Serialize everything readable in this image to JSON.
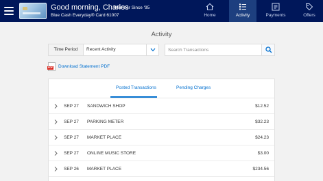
{
  "header": {
    "greeting": "Good morning, Charles",
    "member_since": "Member Since '95",
    "card_name": "Blue Cash Everyday® Card 61007",
    "nav": [
      {
        "label": "Home",
        "icon": "home-icon",
        "active": false
      },
      {
        "label": "Activity",
        "icon": "activity-icon",
        "active": true
      },
      {
        "label": "Payments",
        "icon": "payments-icon",
        "active": false
      },
      {
        "label": "Offers",
        "icon": "offers-icon",
        "active": false
      }
    ]
  },
  "page": {
    "title": "Activity"
  },
  "filter": {
    "label": "Time Period",
    "value": "Recent Activity"
  },
  "search": {
    "placeholder": "Search Transactions"
  },
  "statement": {
    "link": "Download Statement PDF",
    "badge": "PDF"
  },
  "tabs": {
    "posted": "Posted Transactions",
    "pending": "Pending Charges"
  },
  "transactions": [
    {
      "date": "SEP 27",
      "description": "SANDWICH SHOP",
      "amount": "$12.52"
    },
    {
      "date": "SEP 27",
      "description": "PARKING METER",
      "amount": "$32.23"
    },
    {
      "date": "SEP 27",
      "description": "MARKET PLACE",
      "amount": "$24.23"
    },
    {
      "date": "SEP 27",
      "description": "ONLINE MUSIC STORE",
      "amount": "$3.00"
    },
    {
      "date": "SEP 26",
      "description": "MARKET PLACE",
      "amount": "$234.56"
    }
  ],
  "colors": {
    "brand_navy": "#00175a",
    "active_tab": "#1d3f7f",
    "link_blue": "#006fcf"
  }
}
